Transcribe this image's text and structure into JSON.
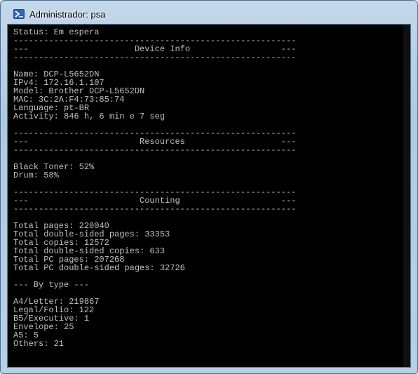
{
  "window": {
    "title": "Administrador: psa",
    "icon": "powershell-icon"
  },
  "console": {
    "lines": [
      "Status: Em espera",
      "--------------------------------------------------------",
      "---                     Device Info                  ---",
      "--------------------------------------------------------",
      "",
      "Name: DCP-L5652DN",
      "IPv4: 172.16.1.107",
      "Model: Brother DCP-L5652DN",
      "MAC: 3C:2A:F4:73:85:74",
      "Language: pt-BR",
      "Activity: 846 h, 6 min e 7 seg",
      "",
      "--------------------------------------------------------",
      "---                      Resources                   ---",
      "--------------------------------------------------------",
      "",
      "Black Toner: 52%",
      "Drum: 58%",
      "",
      "--------------------------------------------------------",
      "---                      Counting                    ---",
      "--------------------------------------------------------",
      "",
      "Total pages: 220040",
      "Total double-sided pages: 33353",
      "Total copies: 12572",
      "Total double-sided copies: 633",
      "Total PC pages: 207268",
      "Total PC double-sided pages: 32726",
      "",
      "--- By type ---",
      "",
      "A4/Letter: 219867",
      "Legal/Folio: 122",
      "B5/Executive: 1",
      "Envelope: 25",
      "A5: 5",
      "Others: 21"
    ]
  }
}
